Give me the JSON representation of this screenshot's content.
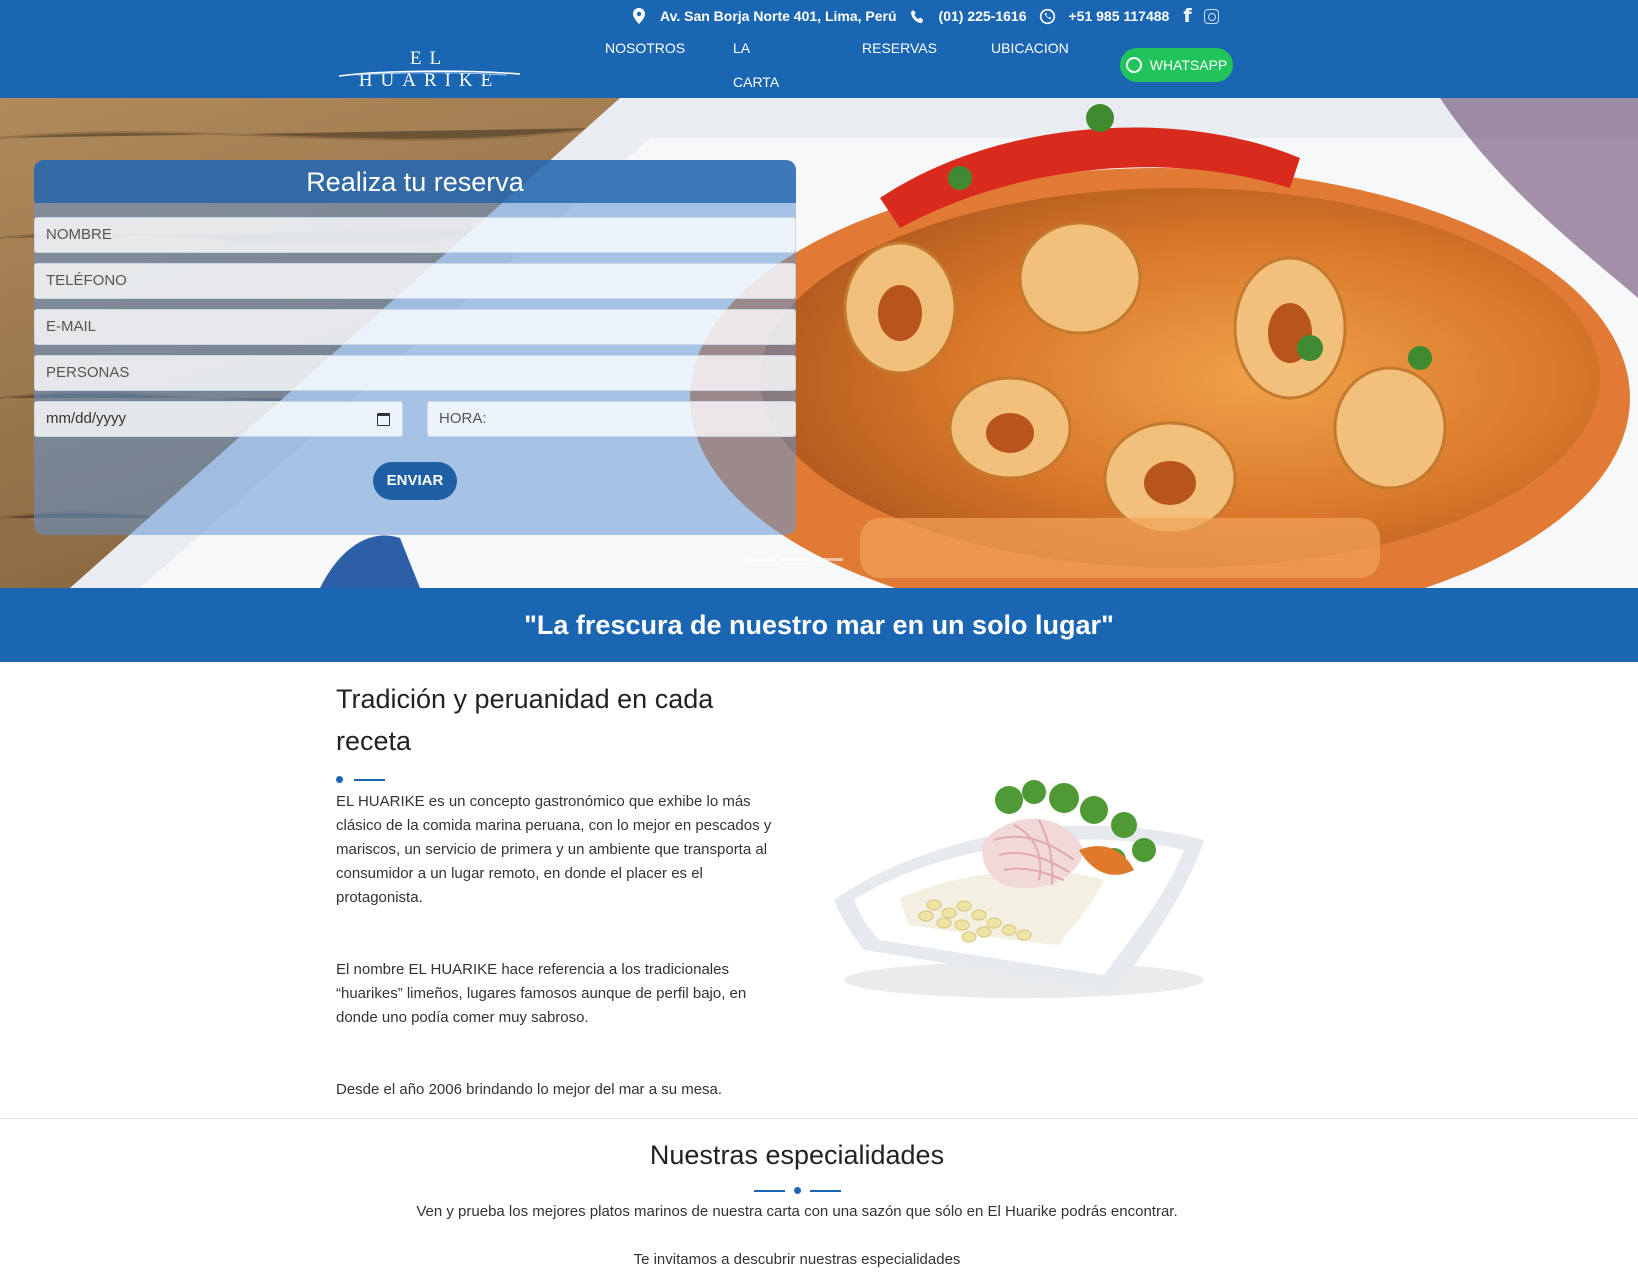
{
  "header": {
    "address": "Av. San Borja Norte 401, Lima, Perú",
    "phone": "(01) 225-1616",
    "whatsapp_number": "+51 985 117488",
    "social": [
      "facebook-icon",
      "instagram-icon"
    ],
    "logo_text": "EL HUARIKE",
    "nav": {
      "nosotros": "NOSOTROS",
      "carta": "LA CARTA",
      "reservas": "RESERVAS",
      "ubicacion": "UBICACION",
      "whatsapp": "WHATSAPP"
    },
    "brand_color": "#1a66b3",
    "whatsapp_color": "#21c45b"
  },
  "hero": {
    "form": {
      "title": "Realiza tu reserva",
      "nombre_placeholder": "NOMBRE",
      "telefono_placeholder": "TELÉFONO",
      "email_placeholder": "E-MAIL",
      "personas_placeholder": "PERSONAS",
      "date_placeholder": "mm/dd/yyyy",
      "hora_placeholder": "HORA:",
      "submit": "ENVIAR"
    },
    "carousel": {
      "slides": 3,
      "active_slide": 2
    }
  },
  "slogan": "\"La frescura de nuestro mar en un solo lugar\"",
  "about": {
    "title": "Tradición y peruanidad en cada receta",
    "paragraphs": [
      "EL HUARIKE es un concepto gastronómico que exhibe lo más clásico de la comida marina peruana, con lo mejor en pescados y mariscos, un servicio de primera y un ambiente que transporta al consumidor a un lugar remoto, en donde el placer es el protagonista.",
      "El nombre EL HUARIKE hace referencia a los tradicionales “huarikes” limeños, lugares famosos aunque de perfil bajo, en donde uno podía comer muy sabroso.",
      "Desde el año 2006 brindando lo mejor del mar a su mesa."
    ]
  },
  "specialties": {
    "title": "Nuestras especialidades",
    "lines": [
      "Ven y prueba los mejores platos marinos de nuestra carta con una sazón que sólo en El Huarike podrás encontrar.",
      "Te invitamos a descubrir nuestras especialidades"
    ]
  }
}
